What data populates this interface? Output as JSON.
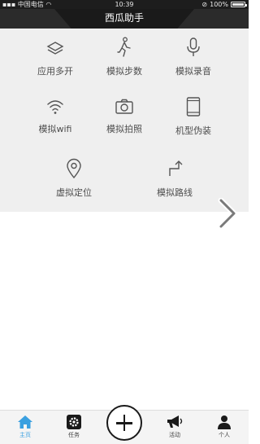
{
  "status_bar": {
    "carrier": "中国电信",
    "time": "10:39",
    "battery": "100%"
  },
  "header": {
    "title": "西瓜助手"
  },
  "features": [
    {
      "label": "应用多开",
      "icon": "layers-icon"
    },
    {
      "label": "模拟步数",
      "icon": "walking-icon"
    },
    {
      "label": "模拟录音",
      "icon": "microphone-icon"
    },
    {
      "label": "模拟wifi",
      "icon": "wifi-icon"
    },
    {
      "label": "模拟拍照",
      "icon": "camera-icon"
    },
    {
      "label": "机型伪装",
      "icon": "phone-icon"
    },
    {
      "label": "虚拟定位",
      "icon": "location-pin-icon"
    },
    {
      "label": "模拟路线",
      "icon": "route-arrow-icon"
    }
  ],
  "bottom_nav": {
    "tabs": [
      {
        "label": "主页",
        "icon": "home-icon",
        "active": true
      },
      {
        "label": "任务",
        "icon": "gear-icon",
        "active": false
      },
      {
        "label": "活动",
        "icon": "megaphone-icon",
        "active": false
      },
      {
        "label": "个人",
        "icon": "person-icon",
        "active": false
      }
    ]
  },
  "colors": {
    "status_bar": "#1d1d1d",
    "title_bar": "#2b2b2b",
    "panel": "#efefef",
    "active_tab": "#3aa0e0"
  }
}
